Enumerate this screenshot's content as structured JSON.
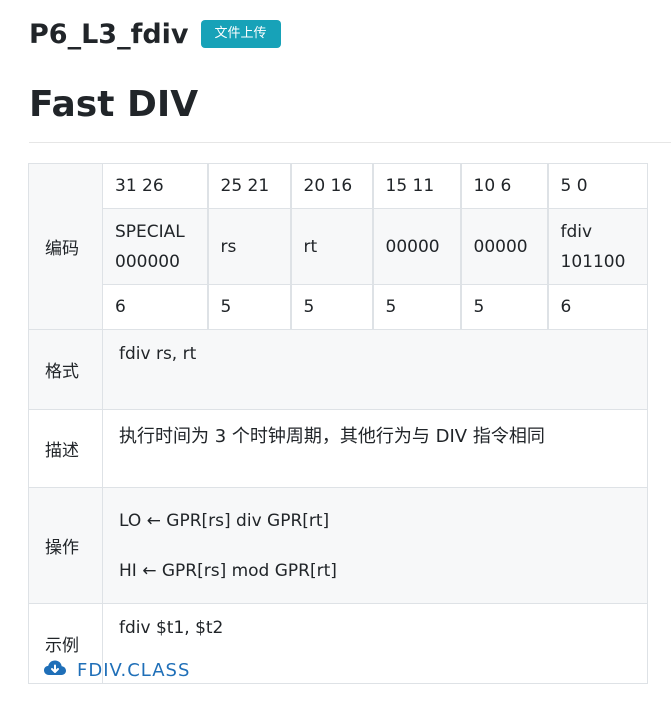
{
  "page": {
    "title": "P6_L3_fdiv",
    "upload_badge": "文件上传",
    "section_title": "Fast DIV"
  },
  "table": {
    "encoding_label": "编码",
    "bit_ranges": [
      "31 26",
      "25 21",
      "20 16",
      "15 11",
      "10 6",
      "5 0"
    ],
    "fields": [
      {
        "line1": "SPECIAL",
        "line2": "000000"
      },
      {
        "line1": "rs",
        "line2": ""
      },
      {
        "line1": "rt",
        "line2": ""
      },
      {
        "line1": "00000",
        "line2": ""
      },
      {
        "line1": "00000",
        "line2": ""
      },
      {
        "line1": "fdiv",
        "line2": "101100"
      }
    ],
    "widths": [
      "6",
      "5",
      "5",
      "5",
      "5",
      "6"
    ],
    "format_label": "格式",
    "format_value": "fdiv rs, rt",
    "description_label": "描述",
    "description_value": "执行时间为 3 个时钟周期，其他行为与 DIV 指令相同",
    "operation_label": "操作",
    "operation_lines": [
      "LO ← GPR[rs] div GPR[rt]",
      "HI ← GPR[rs] mod GPR[rt]"
    ],
    "example_label": "示例",
    "example_value": "fdiv $t1, $t2"
  },
  "download": {
    "label": "FDIV.CLASS",
    "icon": "cloud-download-icon",
    "color": "#1f6fb8"
  },
  "colors": {
    "badge_bg": "#17a2b8",
    "stripe_bg": "#f7f8f9",
    "border": "#dee2e6"
  }
}
